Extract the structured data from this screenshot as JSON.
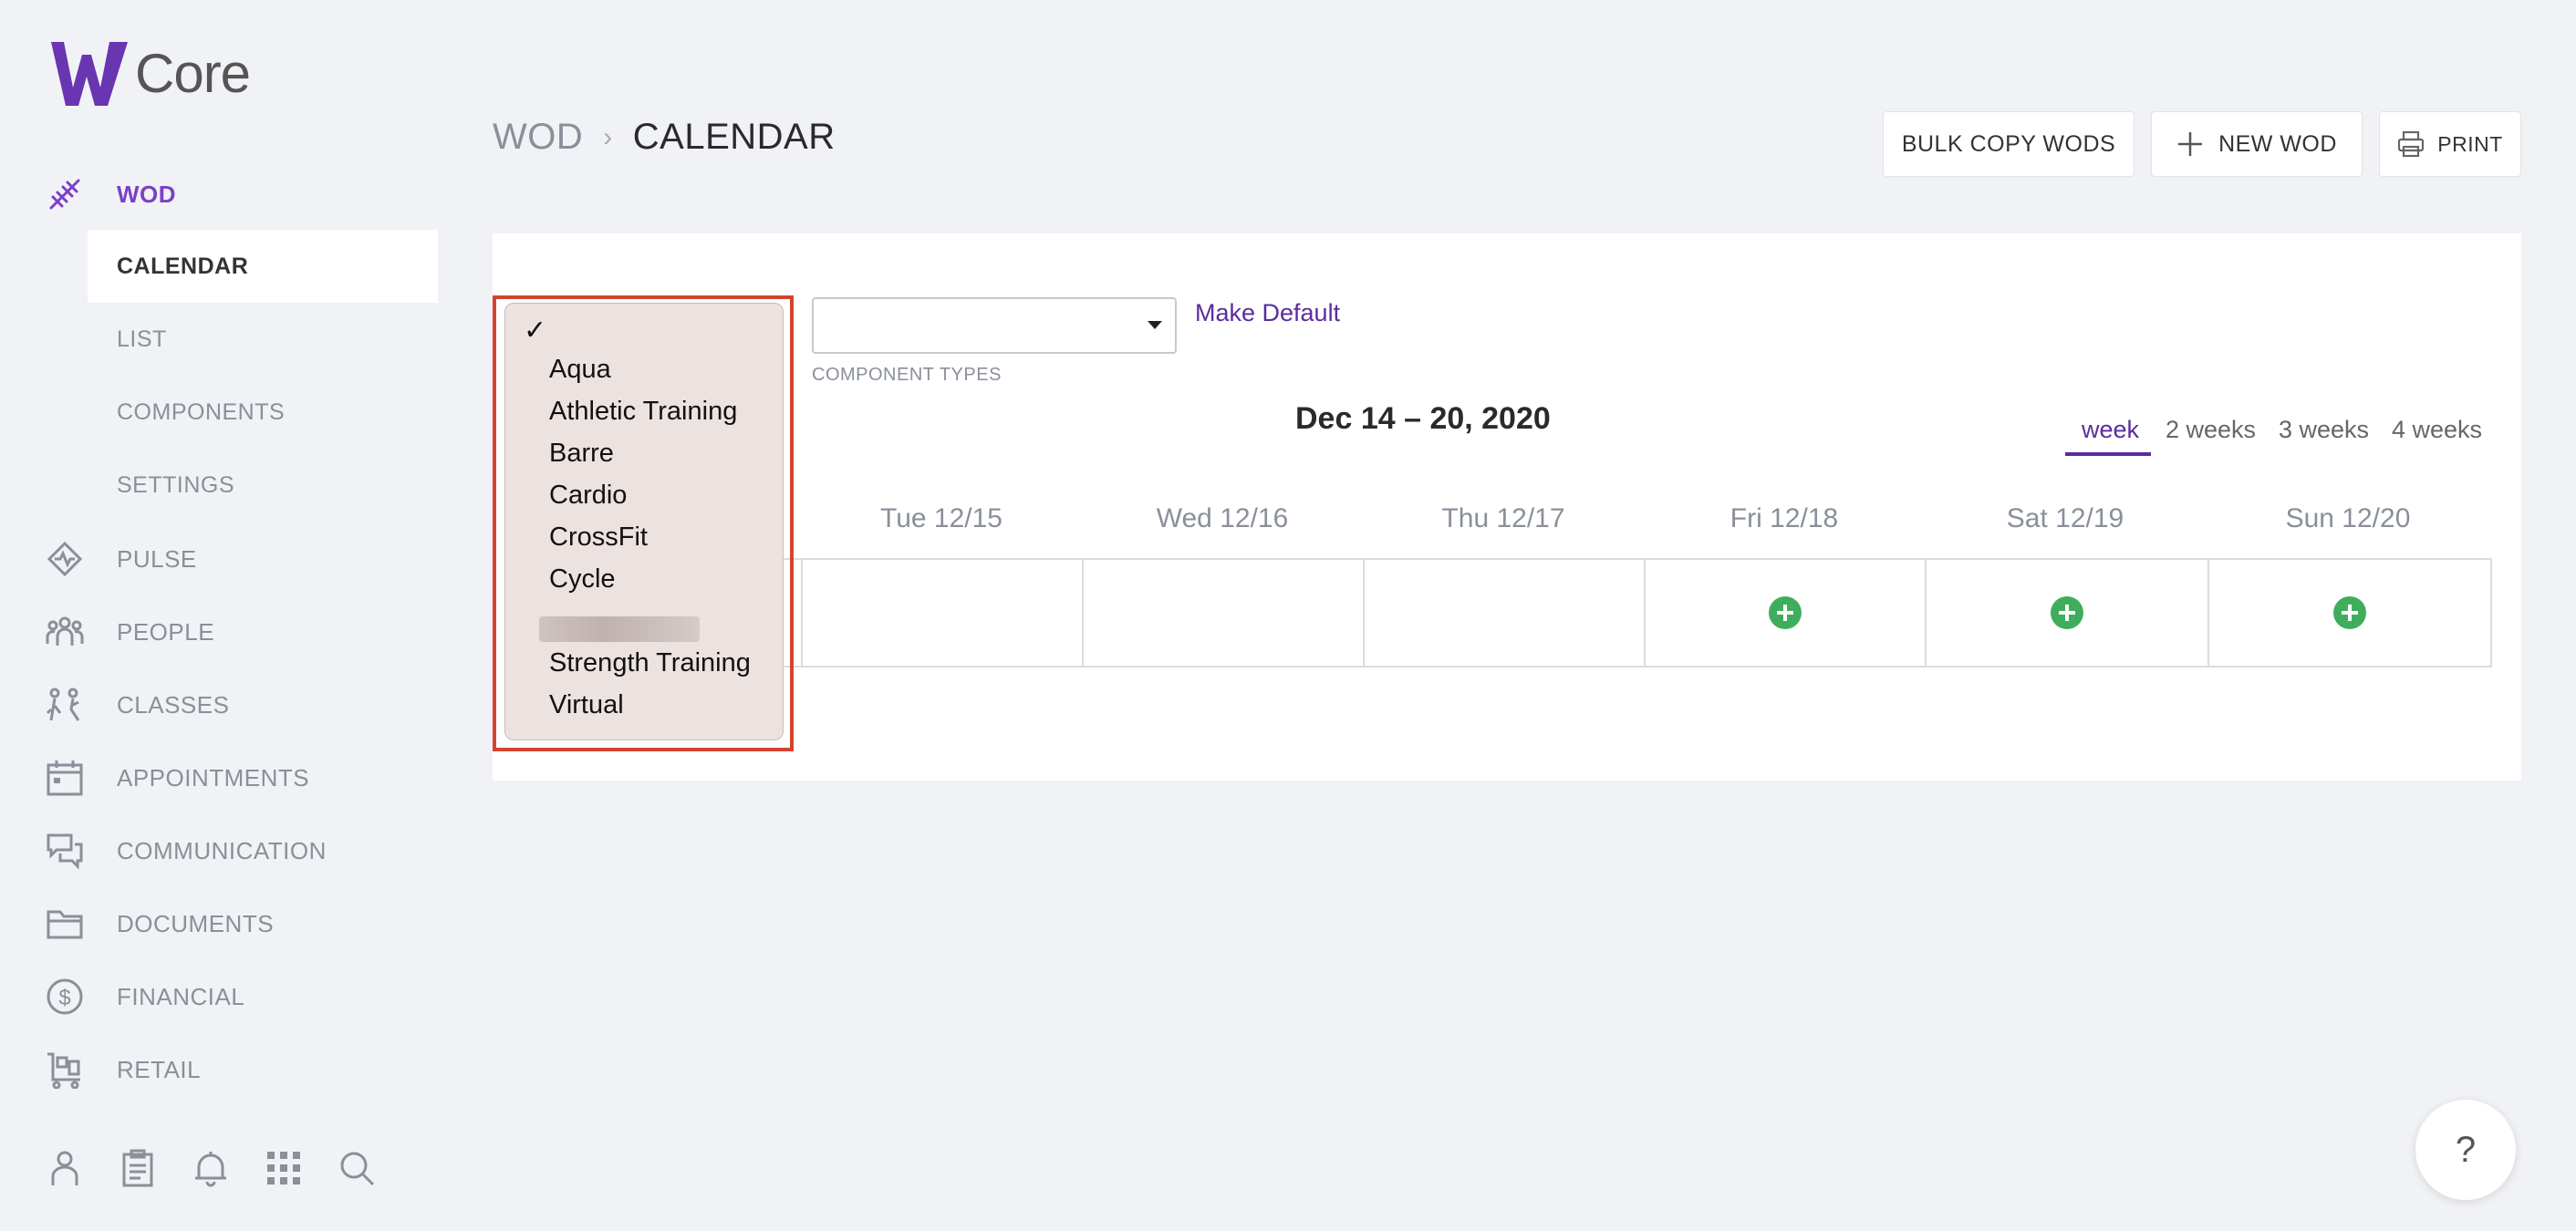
{
  "app": {
    "logo_text": "Core"
  },
  "sidebar": {
    "wod": "WOD",
    "sub": [
      "CALENDAR",
      "LIST",
      "COMPONENTS",
      "SETTINGS"
    ],
    "items": [
      "PULSE",
      "PEOPLE",
      "CLASSES",
      "APPOINTMENTS",
      "COMMUNICATION",
      "DOCUMENTS",
      "FINANCIAL",
      "RETAIL"
    ]
  },
  "breadcrumb": {
    "root": "WOD",
    "separator": "›",
    "current": "CALENDAR"
  },
  "header": {
    "bulk_copy": "BULK COPY WODS",
    "new_wod": "NEW WOD",
    "print": "PRINT"
  },
  "filters": {
    "component_types_label": "COMPONENT TYPES",
    "make_default": "Make Default",
    "dropdown_check": "✓",
    "dropdown_options": [
      "Aqua",
      "Athletic Training",
      "Barre",
      "Cardio",
      "CrossFit",
      "Cycle",
      "Strength Training",
      "Virtual"
    ]
  },
  "calendar": {
    "date_range": "Dec 14 – 20, 2020",
    "ranges": [
      "week",
      "2 weeks",
      "3 weeks",
      "4 weeks"
    ],
    "active_range": "week",
    "days": [
      "Tue 12/15",
      "Wed 12/16",
      "Thu 12/17",
      "Fri 12/18",
      "Sat 12/19",
      "Sun 12/20"
    ],
    "add_buttons_on": [
      "Fri 12/18",
      "Sat 12/19",
      "Sun 12/20"
    ]
  },
  "help": {
    "label": "?"
  },
  "colors": {
    "accent": "#7b3fc8",
    "link": "#5a2d9c",
    "add": "#3fae5c",
    "highlight": "#d4432f"
  }
}
